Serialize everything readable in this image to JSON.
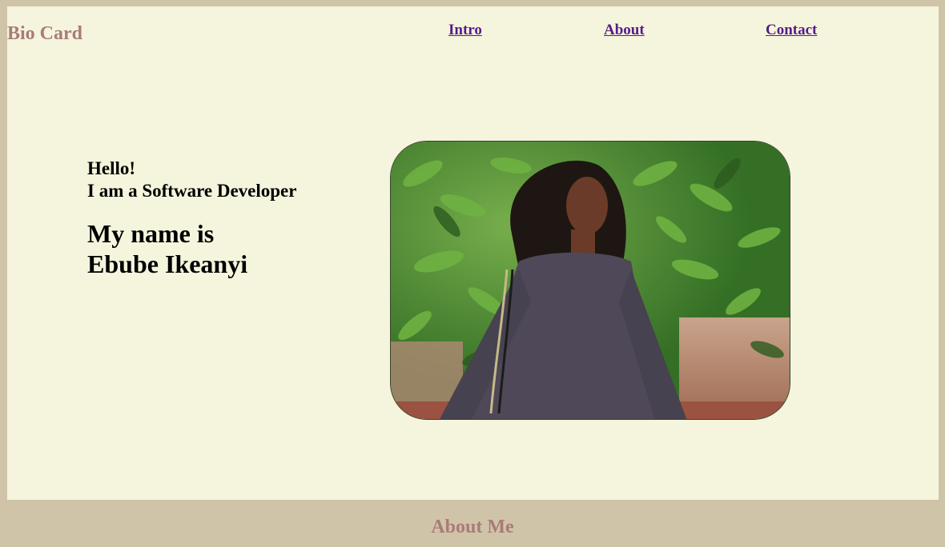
{
  "header": {
    "brand": "Bio Card",
    "nav": [
      {
        "label": "Intro"
      },
      {
        "label": "About"
      },
      {
        "label": "Contact"
      }
    ]
  },
  "intro": {
    "greeting": "Hello!",
    "role": "I am a Software Developer",
    "name_line1": "My name is",
    "name_line2": "Ebube Ikeanyi"
  },
  "photo": {
    "alt": "Portrait photo"
  },
  "footer": {
    "title": "About Me"
  },
  "colors": {
    "page_background": "#d0c4a8",
    "card_background": "#f4f5dc",
    "brand": "#a97b7a",
    "link": "#5a1a8a"
  }
}
